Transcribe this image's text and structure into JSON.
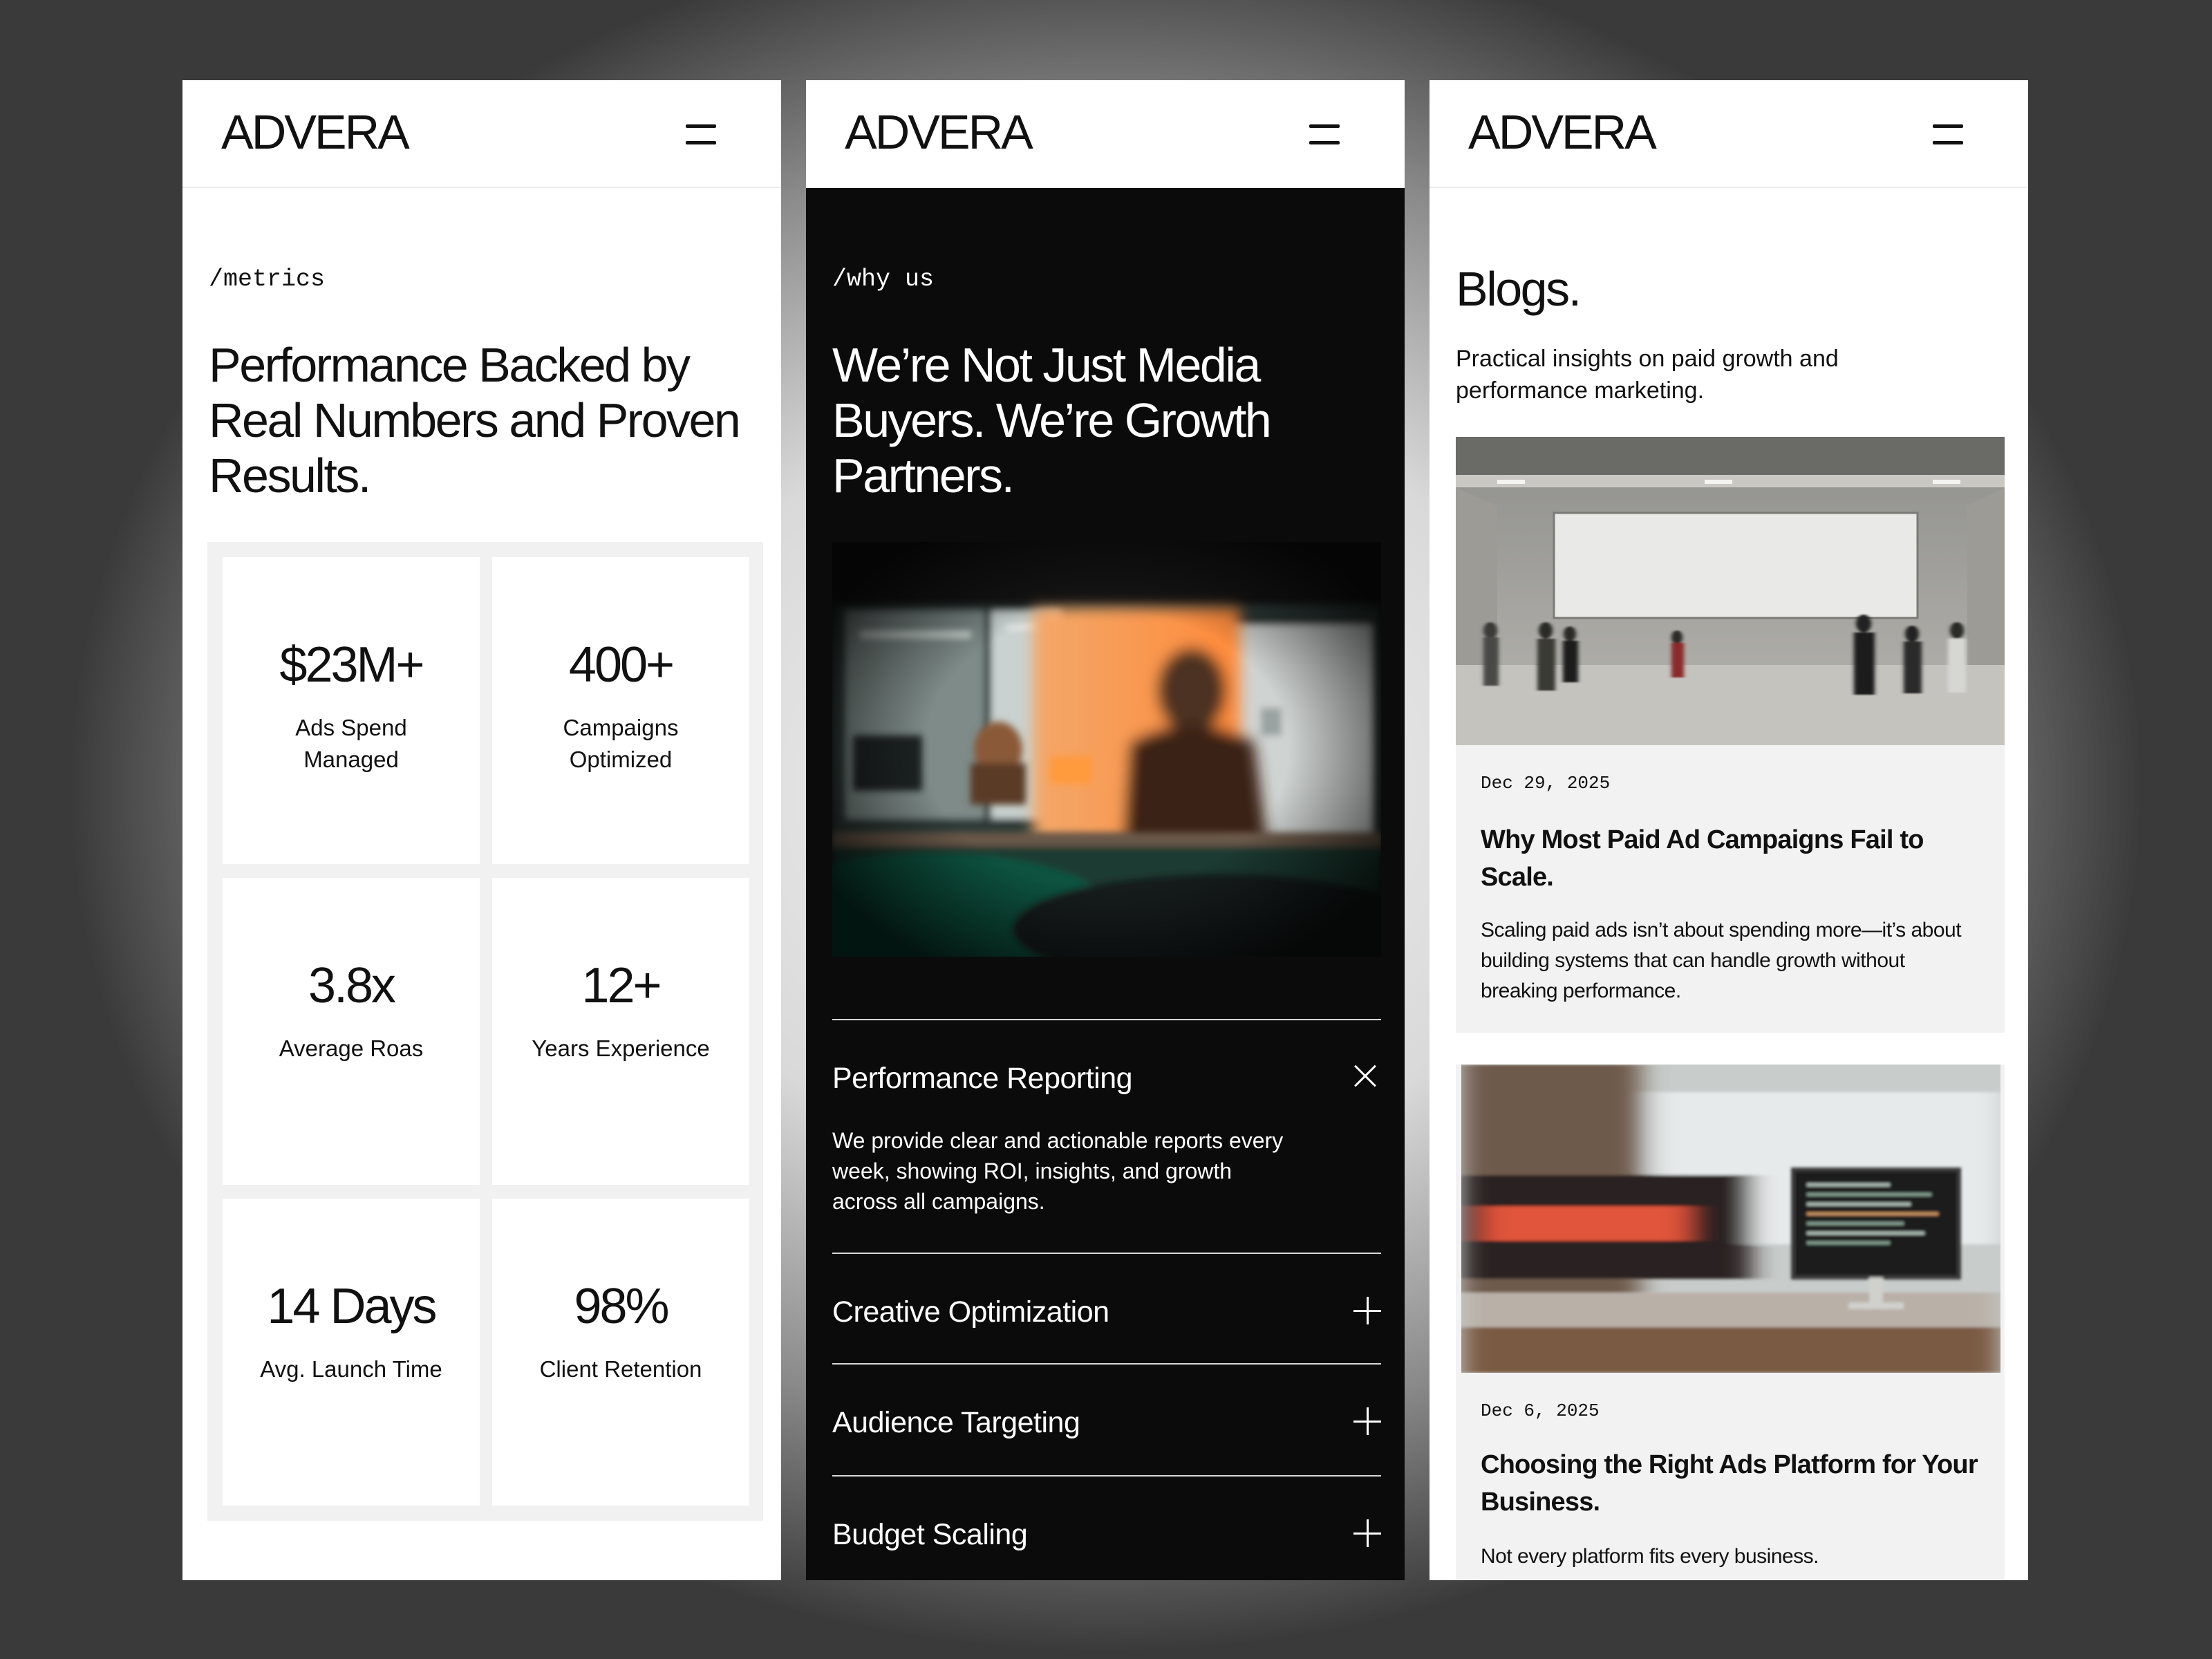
{
  "brand": "ADVERA",
  "metrics_screen": {
    "kicker": "/metrics",
    "heading": "Performance Backed by Real Numbers and Proven Results.",
    "items": [
      {
        "value": "$23M+",
        "label": "Ads Spend Managed"
      },
      {
        "value": "400+",
        "label": "Campaigns Optimized"
      },
      {
        "value": "3.8x",
        "label": "Average Roas"
      },
      {
        "value": "12+",
        "label": "Years Experience"
      },
      {
        "value": "14 Days",
        "label": "Avg. Launch Time"
      },
      {
        "value": "98%",
        "label": "Client Retention"
      }
    ]
  },
  "why_screen": {
    "kicker": "/why us",
    "heading": "We’re Not Just Media Buyers. We’re Growth Partners.",
    "accordion": [
      {
        "title": "Performance Reporting",
        "body": "We provide clear and actionable reports every week, showing ROI, insights, and growth across all campaigns.",
        "icon": "close-icon"
      },
      {
        "title": "Creative Optimization",
        "icon": "plus-icon"
      },
      {
        "title": "Audience Targeting",
        "icon": "plus-icon"
      },
      {
        "title": "Budget Scaling",
        "icon": "plus-icon"
      }
    ]
  },
  "blogs_screen": {
    "title": "Blogs.",
    "subtitle": "Practical insights on paid growth and performance marketing.",
    "posts": [
      {
        "date": "Dec 29, 2025",
        "title": "Why Most Paid Ad Campaigns Fail to Scale.",
        "excerpt": "Scaling paid ads isn’t about spending more—it’s about building systems that can handle growth without breaking performance."
      },
      {
        "date": "Dec 6, 2025",
        "title": "Choosing the Right Ads Platform for Your Business.",
        "excerpt": "Not every platform fits every business."
      }
    ]
  },
  "colors": {
    "dark_bg": "#0b0b0b",
    "card_bg": "#f2f2f2",
    "accent_orange": "#f07a2a"
  }
}
